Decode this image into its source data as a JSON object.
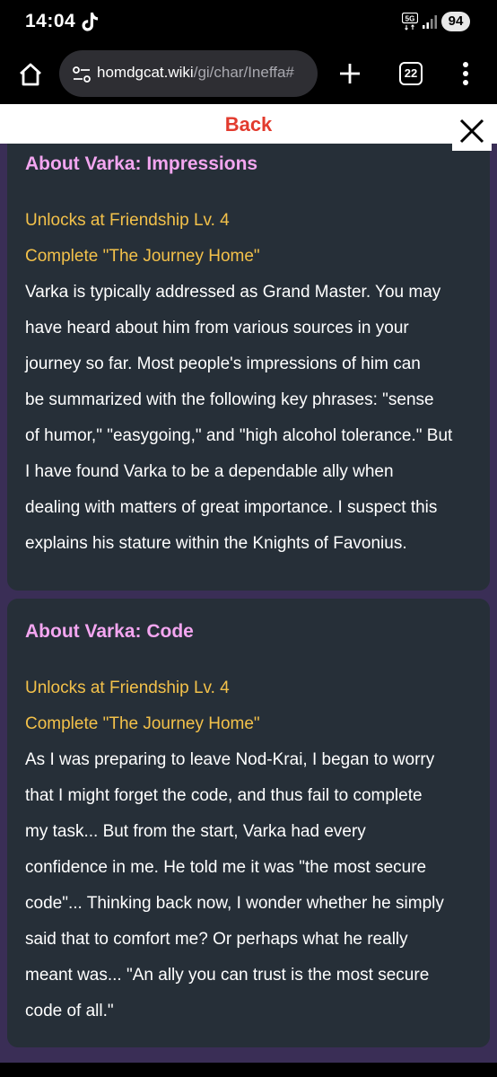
{
  "status_bar": {
    "time": "14:04",
    "network": "5G",
    "battery": "94"
  },
  "browser": {
    "url_host": "homdgcat.wiki",
    "url_path": "/gi/char/Ineffa#",
    "tab_count": "22"
  },
  "page": {
    "back_label": "Back",
    "cards": [
      {
        "title": "About Varka: Impressions",
        "unlock_level": "Unlocks at Friendship Lv. 4",
        "unlock_quest": "Complete \"The Journey Home\"",
        "body_lines": [
          "Varka is typically addressed as Grand Master. You may",
          "have heard about him from various sources in your",
          "journey so far. Most people's impressions of him can",
          "be summarized with the following key phrases: \"sense",
          "of humor,\" \"easygoing,\" and \"high alcohol tolerance.\" But",
          "I have found Varka to be a dependable ally when",
          "dealing with matters of great importance. I suspect this",
          "explains his stature within the Knights of Favonius."
        ]
      },
      {
        "title": "About Varka: Code",
        "unlock_level": "Unlocks at Friendship Lv. 4",
        "unlock_quest": "Complete \"The Journey Home\"",
        "body_lines": [
          "As I was preparing to leave Nod-Krai, I began to worry",
          "that I might forget the code, and thus fail to complete",
          "my task... But from the start, Varka had every",
          "confidence in me. He told me it was \"the most secure",
          "code\"... Thinking back now, I wonder whether he simply",
          "said that to comfort me? Or perhaps what he really",
          "meant was... \"An ally you can trust is the most secure",
          "code of all.\""
        ]
      }
    ]
  },
  "colors": {
    "page_background": "#3a2e56",
    "card_background": "#262f38",
    "title_color": "#f3a6f0",
    "unlock_color": "#f3c14a",
    "back_color": "#e23b2e"
  },
  "icons": {
    "home": "home-icon",
    "site_settings": "tune-icon",
    "new_tab": "plus-icon",
    "tabs": "tab-switcher-icon",
    "menu": "more-vert-icon",
    "close": "close-icon",
    "app_notification": "tiktok-icon"
  }
}
